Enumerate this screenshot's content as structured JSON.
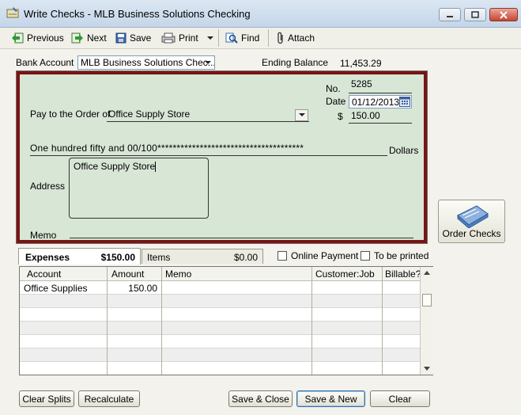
{
  "window": {
    "title": "Write Checks - MLB Business Solutions Checking"
  },
  "toolbar": {
    "previous": "Previous",
    "next": "Next",
    "save": "Save",
    "print": "Print",
    "find": "Find",
    "attach": "Attach"
  },
  "bank": {
    "label": "Bank Account",
    "account": "MLB Business Solutions Chec...",
    "ending_balance_label": "Ending Balance",
    "ending_balance": "11,453.29"
  },
  "check": {
    "no_label": "No.",
    "no": "5285",
    "date_label": "Date",
    "date": "01/12/2013",
    "dollar_sign": "$",
    "amount": "150.00",
    "pay_to_label": "Pay to the Order of",
    "payee": "Office Supply Store",
    "amount_words": "One hundred fifty and 00/100**************************************",
    "dollars_label": "Dollars",
    "address_label": "Address",
    "address": "Office Supply Store",
    "memo_label": "Memo",
    "memo": ""
  },
  "order_checks": {
    "label": "Order Checks"
  },
  "tabs": {
    "expenses_label": "Expenses",
    "expenses_amount": "$150.00",
    "items_label": "Items",
    "items_amount": "$0.00"
  },
  "options": {
    "online_payment": "Online Payment",
    "to_be_printed": "To be printed"
  },
  "grid": {
    "headers": [
      "Account",
      "Amount",
      "Memo",
      "Customer:Job",
      "Billable?"
    ],
    "rows": [
      {
        "account": "Office Supplies",
        "amount": "150.00",
        "memo": "",
        "customer_job": "",
        "billable": ""
      }
    ]
  },
  "buttons": {
    "clear_splits": "Clear Splits",
    "recalculate": "Recalculate",
    "save_close": "Save & Close",
    "save_new": "Save & New",
    "clear": "Clear"
  }
}
